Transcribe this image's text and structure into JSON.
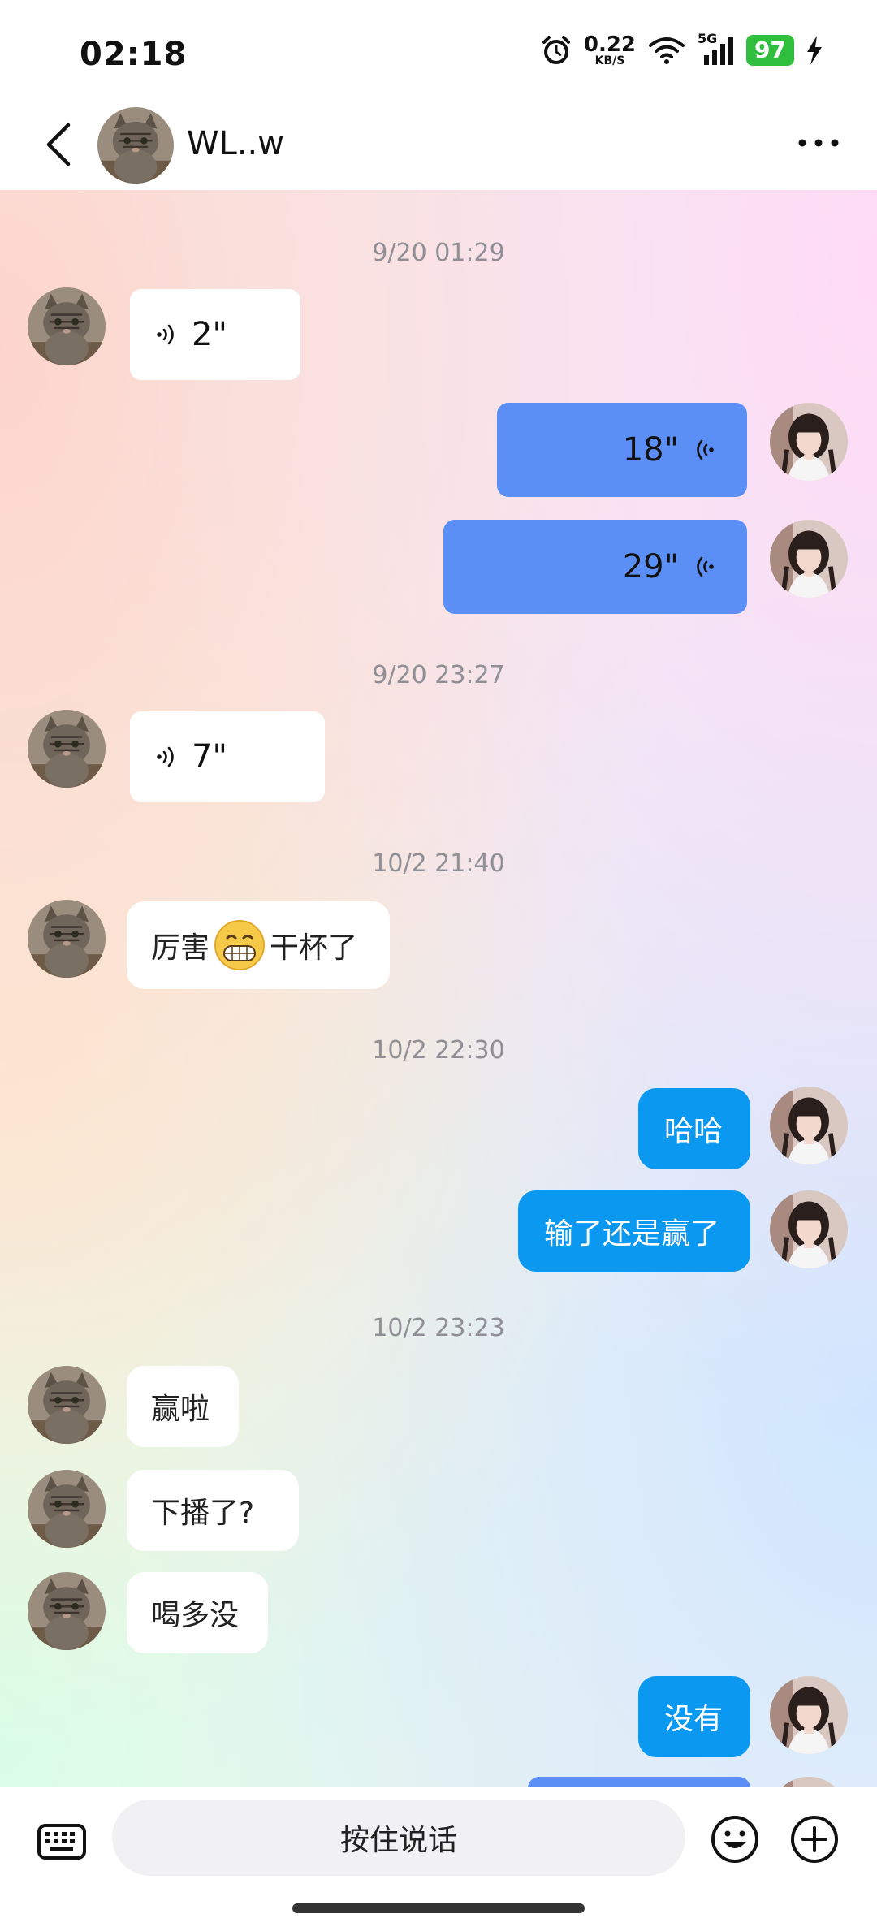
{
  "status_bar": {
    "time": "02:18",
    "net_speed": "0.22",
    "net_unit": "KB/S",
    "signal": "5G",
    "battery": "97"
  },
  "header": {
    "contact_name": "WL..w"
  },
  "messages": {
    "ts1": "9/20 01:29",
    "m1": {
      "duration": "2\""
    },
    "m2": {
      "duration": "18\""
    },
    "m3": {
      "duration": "29\""
    },
    "ts2": "9/20 23:27",
    "m4": {
      "duration": "7\""
    },
    "ts3": "10/2 21:40",
    "m5": {
      "text_a": "厉害",
      "text_b": "干杯了"
    },
    "ts4": "10/2 22:30",
    "m6": {
      "text": "哈哈"
    },
    "m7": {
      "text": "输了还是赢了"
    },
    "ts5": "10/2 23:23",
    "m8": {
      "text": "赢啦"
    },
    "m9": {
      "text": "下播了?"
    },
    "m10": {
      "text": "喝多没"
    },
    "m11": {
      "text": "没有"
    }
  },
  "input_bar": {
    "hold_to_talk": "按住说话"
  },
  "icons": [
    "alarm-icon",
    "wifi-icon",
    "signal-icon",
    "charging-icon",
    "back-icon",
    "more-icon",
    "voice-wave-icon",
    "grin-emoji-icon",
    "keyboard-icon",
    "emoji-icon",
    "plus-icon"
  ],
  "colors": {
    "outgoing_text_bubble": "#0a98f0",
    "outgoing_voice_bubble": "#5b8ff5",
    "battery": "#2fbf3c"
  }
}
